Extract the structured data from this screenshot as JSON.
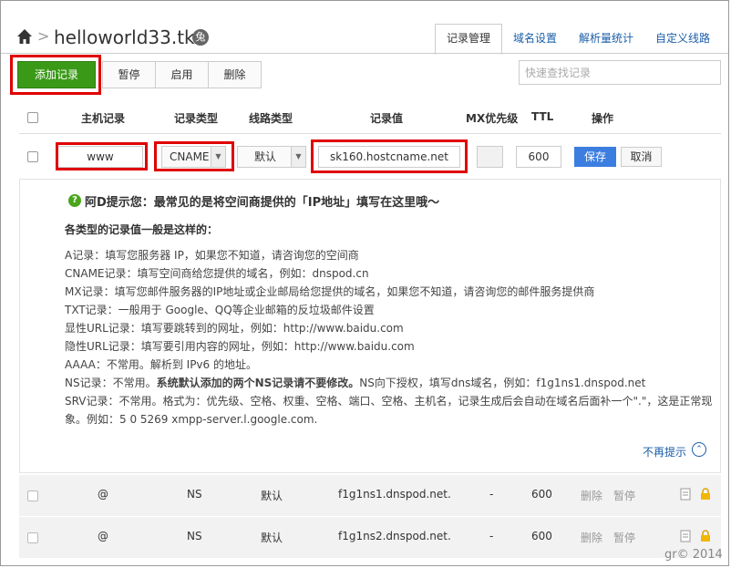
{
  "header": {
    "breadcrumb_sep": ">",
    "domain": "helloworld33.tk",
    "badge": "兔",
    "tabs": [
      {
        "label": "记录管理",
        "active": true
      },
      {
        "label": "域名设置"
      },
      {
        "label": "解析量统计"
      },
      {
        "label": "自定义线路"
      }
    ]
  },
  "toolbar": {
    "add_label": "添加记录",
    "pause_label": "暂停",
    "enable_label": "启用",
    "delete_label": "删除",
    "search_placeholder": "快速查找记录"
  },
  "columns": {
    "host": "主机记录",
    "type": "记录类型",
    "line": "线路类型",
    "value": "记录值",
    "mx": "MX优先级",
    "ttl": "TTL",
    "ops": "操作"
  },
  "edit_row": {
    "host": "www",
    "type": "CNAME",
    "line": "默认",
    "value": "sk160.hostcname.net",
    "mx": "",
    "ttl": "600",
    "save_label": "保存",
    "cancel_label": "取消"
  },
  "tips": {
    "icon": "?",
    "title": "阿D提示您：最常见的是将空间商提供的「IP地址」填写在这里哦～",
    "subtitle": "各类型的记录值一般是这样的：",
    "lines": [
      "A记录：填写您服务器 IP，如果您不知道，请咨询您的空间商",
      "CNAME记录：填写空间商给您提供的域名，例如：dnspod.cn",
      "MX记录：填写您邮件服务器的IP地址或企业邮局给您提供的域名，如果您不知道，请咨询您的邮件服务提供商",
      "TXT记录：一般用于 Google、QQ等企业邮箱的反垃圾邮件设置",
      "显性URL记录：填写要跳转到的网址，例如：http://www.baidu.com",
      "隐性URL记录：填写要引用内容的网址，例如：http://www.baidu.com",
      "AAAA：不常用。解析到 IPv6 的地址。"
    ],
    "ns_prefix": "NS记录：不常用。",
    "ns_bold": "系统默认添加的两个NS记录请不要修改。",
    "ns_suffix": "NS向下授权，填写dns域名，例如：f1g1ns1.dnspod.net",
    "srv_line": "SRV记录：不常用。格式为：优先级、空格、权重、空格、端口、空格、主机名，记录生成后会自动在域名后面补一个\".\"，这是正常现象。例如：5 0 5269 xmpp-server.l.google.com.",
    "dismiss_label": "不再提示",
    "dismiss_icon": "⌃"
  },
  "records": [
    {
      "host": "@",
      "type": "NS",
      "line": "默认",
      "value": "f1g1ns1.dnspod.net.",
      "mx": "-",
      "ttl": "600",
      "delete": "删除",
      "pause": "暂停"
    },
    {
      "host": "@",
      "type": "NS",
      "line": "默认",
      "value": "f1g1ns2.dnspod.net.",
      "mx": "-",
      "ttl": "600",
      "delete": "删除",
      "pause": "暂停"
    }
  ],
  "watermark": "gr© 2014",
  "colors": {
    "add_button": "#3a9a17",
    "highlight": "#e00000",
    "save_button": "#3b7ee0",
    "link": "#1a5ea8"
  }
}
